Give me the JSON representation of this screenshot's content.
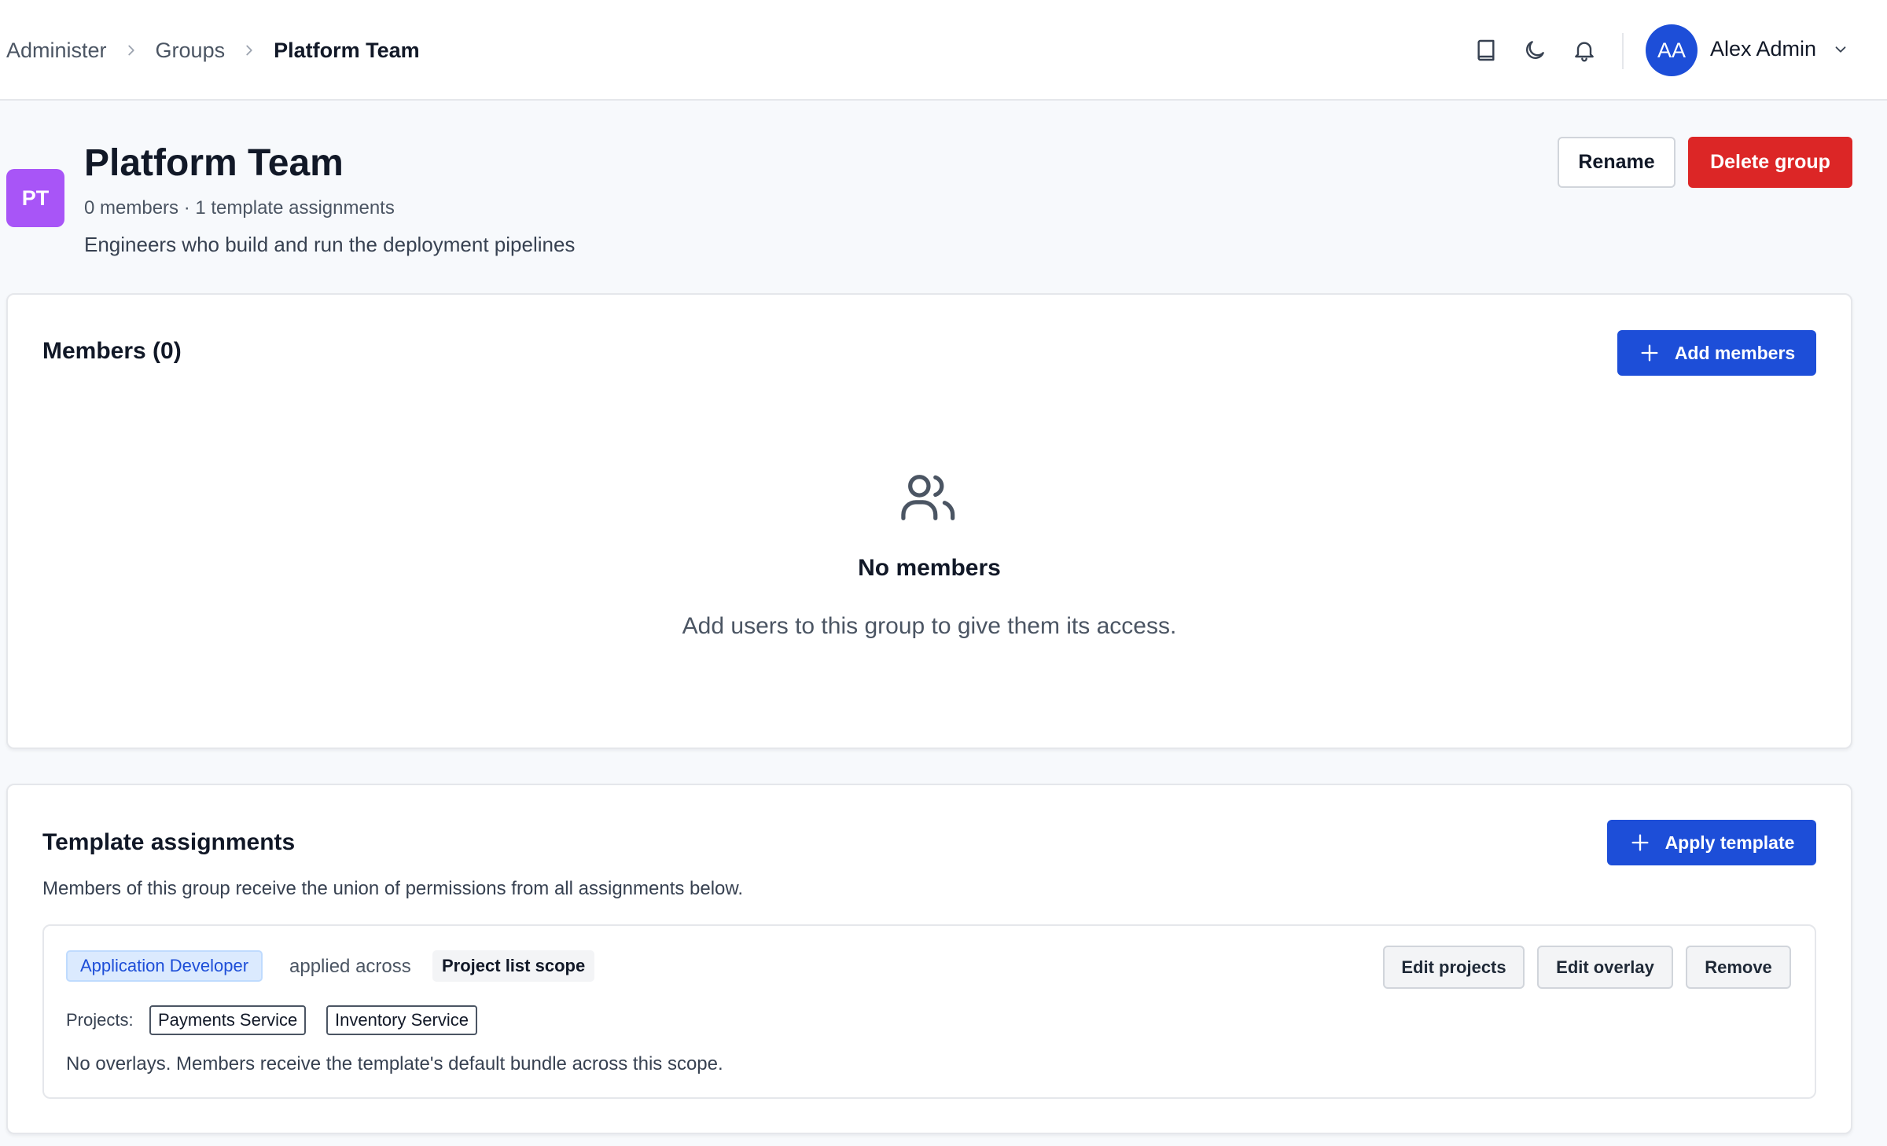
{
  "breadcrumb": {
    "items": [
      "Administer",
      "Groups"
    ],
    "current": "Platform Team"
  },
  "user": {
    "initials": "AA",
    "name": "Alex Admin"
  },
  "group": {
    "initials": "PT",
    "title": "Platform Team",
    "meta": "0 members · 1 template assignments",
    "description": "Engineers who build and run the deployment pipelines"
  },
  "actions": {
    "rename": "Rename",
    "delete": "Delete group"
  },
  "members": {
    "title": "Members (0)",
    "add_label": "Add members",
    "empty_title": "No members",
    "empty_text": "Add users to this group to give them its access."
  },
  "templates": {
    "title": "Template assignments",
    "subtitle": "Members of this group receive the union of permissions from all assignments below.",
    "apply_label": "Apply template",
    "assignment": {
      "template_name": "Application Developer",
      "applied_text": "applied across",
      "scope": "Project list scope",
      "projects_label": "Projects:",
      "projects": [
        "Payments Service",
        "Inventory Service"
      ],
      "note": "No overlays. Members receive the template's default bundle across this scope.",
      "edit_projects": "Edit projects",
      "edit_overlay": "Edit overlay",
      "remove": "Remove"
    }
  },
  "colors": {
    "primary": "#1d4ed8",
    "danger": "#dc2626",
    "group_badge": "#a855f7",
    "template_chip_bg": "#dbeafe"
  },
  "icons": {
    "topbar": [
      "book-icon",
      "moon-icon",
      "bell-icon"
    ],
    "empty_state": "users-icon"
  }
}
